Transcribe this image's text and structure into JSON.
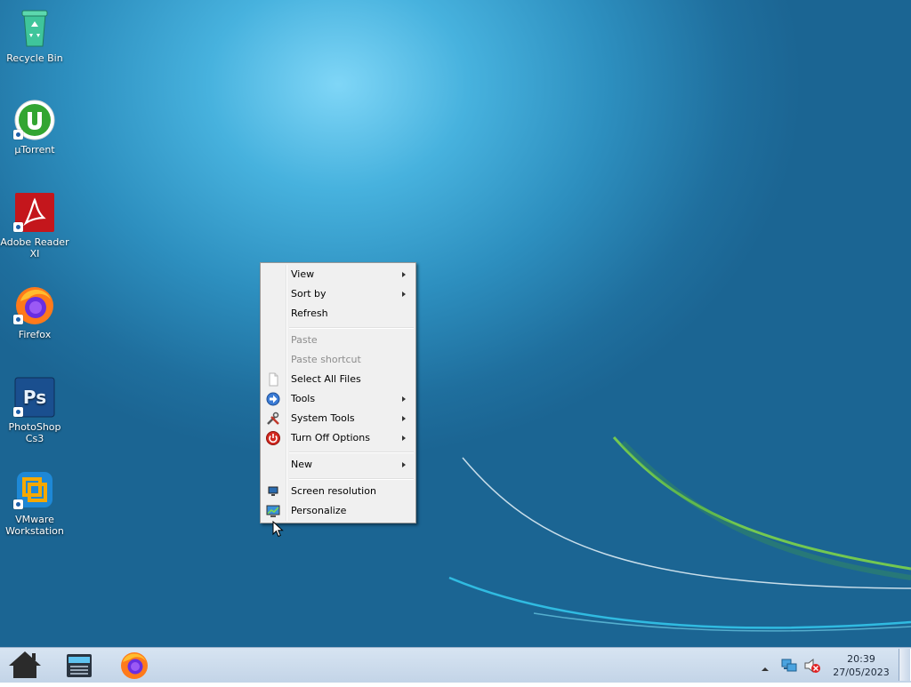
{
  "desktop_icons": [
    {
      "label": "Recycle Bin",
      "icon": "recycle-bin-icon"
    },
    {
      "label": "µTorrent",
      "icon": "utorrent-icon"
    },
    {
      "label": "Adobe Reader XI",
      "icon": "adobe-reader-icon"
    },
    {
      "label": "Firefox",
      "icon": "firefox-icon"
    },
    {
      "label": "PhotoShop Cs3",
      "icon": "photoshop-icon"
    },
    {
      "label": "VMware Workstation",
      "icon": "vmware-icon"
    }
  ],
  "context_menu": {
    "view": "View",
    "sort_by": "Sort by",
    "refresh": "Refresh",
    "paste": "Paste",
    "paste_shortcut": "Paste shortcut",
    "select_all_files": "Select All Files",
    "tools": "Tools",
    "system_tools": "System Tools",
    "turn_off_options": "Turn Off Options",
    "new": "New",
    "screen_resolution": "Screen resolution",
    "personalize": "Personalize"
  },
  "taskbar": {
    "apps": [
      {
        "icon": "home-icon"
      },
      {
        "icon": "file-manager-icon"
      },
      {
        "icon": "firefox-icon"
      }
    ],
    "tray": {
      "time": "20:39",
      "date": "27/05/2023",
      "icons": [
        "show-hidden-icons-arrow",
        "network-icon",
        "volume-muted-icon"
      ]
    }
  },
  "colors": {
    "desktop_accent": "#47b2de",
    "menu_bg": "#f0f0f0",
    "taskbar_bg": "#c3d4e7"
  }
}
